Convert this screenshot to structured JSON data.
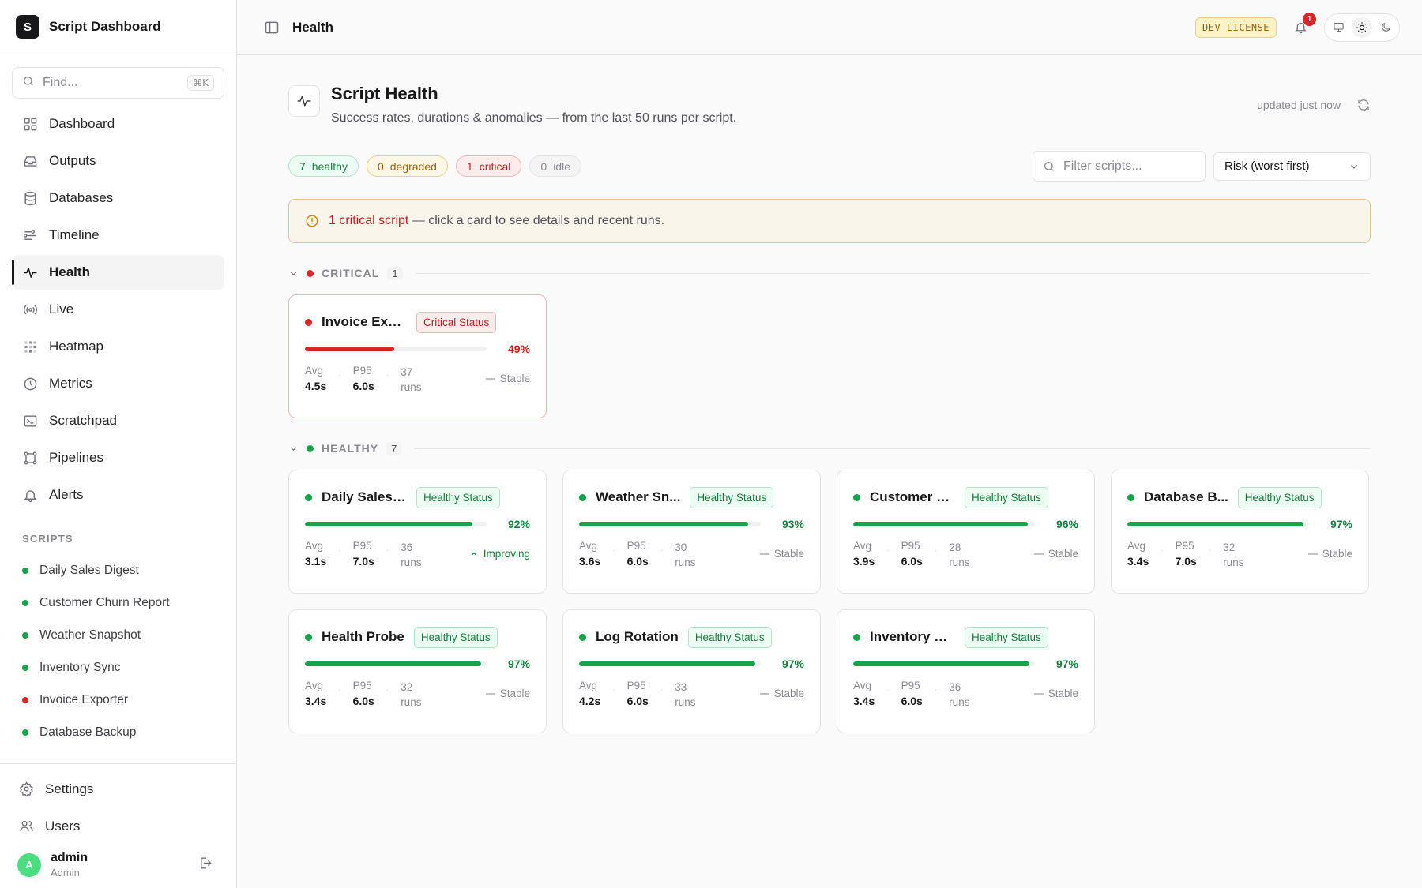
{
  "app": {
    "name": "Script Dashboard",
    "logo_letter": "S"
  },
  "search": {
    "placeholder": "Find...",
    "shortcut": "⌘K"
  },
  "nav": [
    {
      "label": "Dashboard",
      "icon": "grid-icon"
    },
    {
      "label": "Outputs",
      "icon": "inbox-icon"
    },
    {
      "label": "Databases",
      "icon": "database-icon"
    },
    {
      "label": "Timeline",
      "icon": "timeline-icon"
    },
    {
      "label": "Health",
      "icon": "activity-icon",
      "active": true
    },
    {
      "label": "Live",
      "icon": "broadcast-icon"
    },
    {
      "label": "Heatmap",
      "icon": "heatmap-icon"
    },
    {
      "label": "Metrics",
      "icon": "clock-icon"
    },
    {
      "label": "Scratchpad",
      "icon": "terminal-icon"
    },
    {
      "label": "Pipelines",
      "icon": "pipeline-icon"
    },
    {
      "label": "Alerts",
      "icon": "bell-icon"
    }
  ],
  "scripts_section": {
    "label": "SCRIPTS",
    "items": [
      {
        "name": "Daily Sales Digest",
        "status": "healthy"
      },
      {
        "name": "Customer Churn Report",
        "status": "healthy"
      },
      {
        "name": "Weather Snapshot",
        "status": "healthy"
      },
      {
        "name": "Inventory Sync",
        "status": "healthy"
      },
      {
        "name": "Invoice Exporter",
        "status": "critical"
      },
      {
        "name": "Database Backup",
        "status": "healthy"
      }
    ]
  },
  "bottom_nav": {
    "settings": "Settings",
    "users": "Users"
  },
  "user": {
    "initial": "A",
    "name": "admin",
    "role": "Admin"
  },
  "topbar": {
    "title": "Health",
    "license": "DEV LICENSE",
    "notifications": "1"
  },
  "header": {
    "title": "Script Health",
    "subtitle": "Success rates, durations & anomalies — from the last 50 runs per script.",
    "updated": "updated just now"
  },
  "summary": {
    "healthy": {
      "count": "7",
      "label": "healthy"
    },
    "degraded": {
      "count": "0",
      "label": "degraded"
    },
    "critical": {
      "count": "1",
      "label": "critical"
    },
    "idle": {
      "count": "0",
      "label": "idle"
    }
  },
  "filter": {
    "placeholder": "Filter scripts...",
    "sort": "Risk (worst first)"
  },
  "banner": {
    "highlight": "1 critical script",
    "text": " — click a card to see details and recent runs."
  },
  "labels": {
    "avg": "Avg",
    "p95": "P95"
  },
  "colors": {
    "healthy": "#16a34a",
    "critical": "#dc2626",
    "degraded": "#ca8a04"
  },
  "groups": [
    {
      "name": "CRITICAL",
      "status": "critical",
      "count": "1",
      "cards": [
        {
          "name": "Invoice Expo...",
          "badge": "Critical Status",
          "status": "critical",
          "success": 49,
          "pct": "49%",
          "avg": "4.5s",
          "p95": "6.0s",
          "runs_n": "37",
          "runs_l": "runs",
          "trend": "Stable",
          "trend_kind": "stable"
        }
      ]
    },
    {
      "name": "HEALTHY",
      "status": "healthy",
      "count": "7",
      "cards": [
        {
          "name": "Daily Sales ...",
          "badge": "Healthy Status",
          "status": "healthy",
          "success": 92,
          "pct": "92%",
          "avg": "3.1s",
          "p95": "7.0s",
          "runs_n": "36",
          "runs_l": "runs",
          "trend": "Improving",
          "trend_kind": "improving"
        },
        {
          "name": "Weather Sn...",
          "badge": "Healthy Status",
          "status": "healthy",
          "success": 93,
          "pct": "93%",
          "avg": "3.6s",
          "p95": "6.0s",
          "runs_n": "30",
          "runs_l": "runs",
          "trend": "Stable",
          "trend_kind": "stable"
        },
        {
          "name": "Customer C...",
          "badge": "Healthy Status",
          "status": "healthy",
          "success": 96,
          "pct": "96%",
          "avg": "3.9s",
          "p95": "6.0s",
          "runs_n": "28",
          "runs_l": "runs",
          "trend": "Stable",
          "trend_kind": "stable"
        },
        {
          "name": "Database B...",
          "badge": "Healthy Status",
          "status": "healthy",
          "success": 97,
          "pct": "97%",
          "avg": "3.4s",
          "p95": "7.0s",
          "runs_n": "32",
          "runs_l": "runs",
          "trend": "Stable",
          "trend_kind": "stable"
        },
        {
          "name": "Health Probe",
          "badge": "Healthy Status",
          "status": "healthy",
          "success": 97,
          "pct": "97%",
          "avg": "3.4s",
          "p95": "6.0s",
          "runs_n": "32",
          "runs_l": "runs",
          "trend": "Stable",
          "trend_kind": "stable"
        },
        {
          "name": "Log Rotation",
          "badge": "Healthy Status",
          "status": "healthy",
          "success": 97,
          "pct": "97%",
          "avg": "4.2s",
          "p95": "6.0s",
          "runs_n": "33",
          "runs_l": "runs",
          "trend": "Stable",
          "trend_kind": "stable"
        },
        {
          "name": "Inventory Sy...",
          "badge": "Healthy Status",
          "status": "healthy",
          "success": 97,
          "pct": "97%",
          "avg": "3.4s",
          "p95": "6.0s",
          "runs_n": "36",
          "runs_l": "runs",
          "trend": "Stable",
          "trend_kind": "stable"
        }
      ]
    }
  ]
}
